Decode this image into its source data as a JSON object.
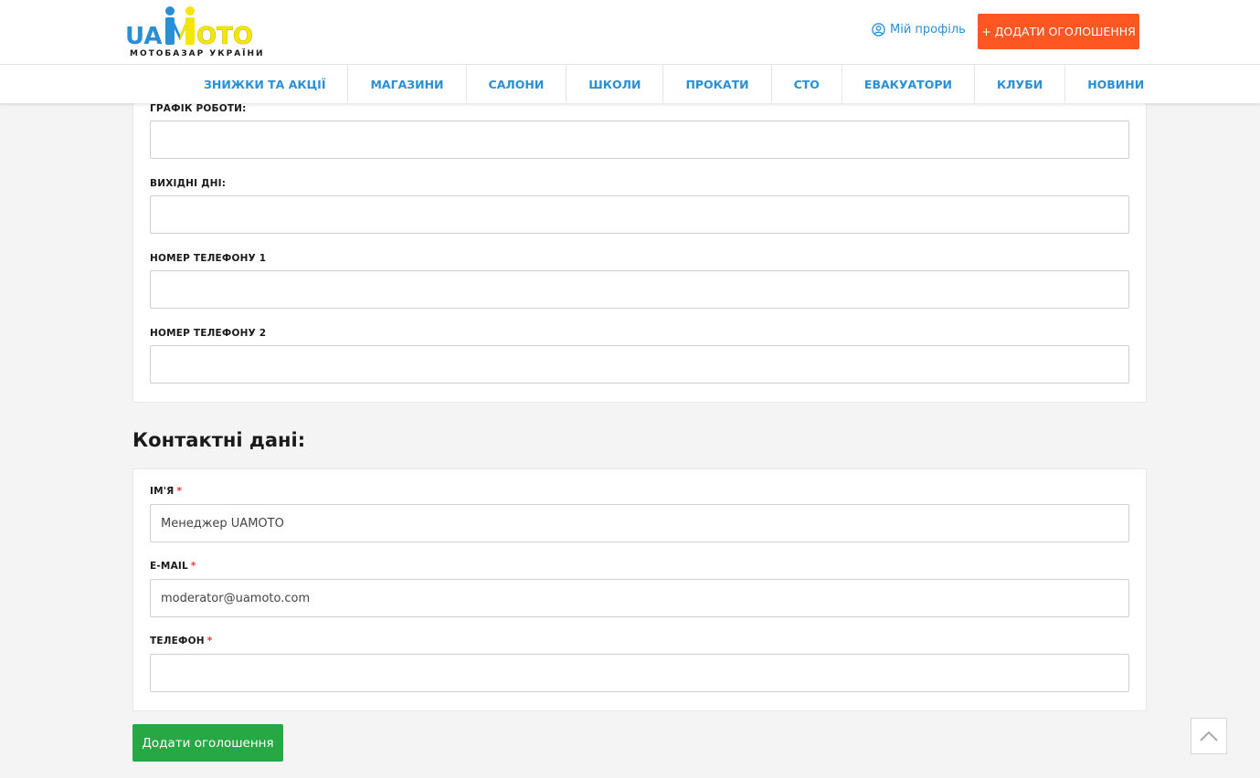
{
  "header": {
    "logo_text_ua": "UA",
    "logo_text_moto": "OTO",
    "logo_tagline": "МОТОБАЗАР УКРАЇНИ",
    "profile_label": "Мій профіль",
    "add_button_label": "+ ДОДАТИ ОГОЛОШЕННЯ",
    "colors": {
      "brand_blue": "#2a8fd4",
      "brand_yellow": "#f5e600",
      "accent_orange": "#ff5722"
    }
  },
  "nav": {
    "items": [
      "ЗНИЖКИ ТА АКЦІЇ",
      "МАГАЗИНИ",
      "САЛОНИ",
      "ШКОЛИ",
      "ПРОКАТИ",
      "СТО",
      "ЕВАКУАТОРИ",
      "КЛУБИ",
      "НОВИНИ"
    ]
  },
  "schedule_panel": {
    "fields": [
      {
        "label": "ГРАФІК РОБОТИ:",
        "value": ""
      },
      {
        "label": "ВИХІДНІ ДНІ:",
        "value": ""
      },
      {
        "label": "НОМЕР ТЕЛЕФОНУ 1",
        "value": ""
      },
      {
        "label": "НОМЕР ТЕЛЕФОНУ 2",
        "value": ""
      }
    ]
  },
  "contacts": {
    "title": "Контактні дані:",
    "required_mark": "*",
    "fields": [
      {
        "label": "ІМ'Я",
        "value": "Менеджер UAMOTO"
      },
      {
        "label": "E-MAIL",
        "value": "moderator@uamoto.com"
      },
      {
        "label": "ТЕЛЕФОН",
        "value": ""
      }
    ]
  },
  "submit_label": "Додати оголошення",
  "colors": {
    "submit_green": "#28a745"
  }
}
